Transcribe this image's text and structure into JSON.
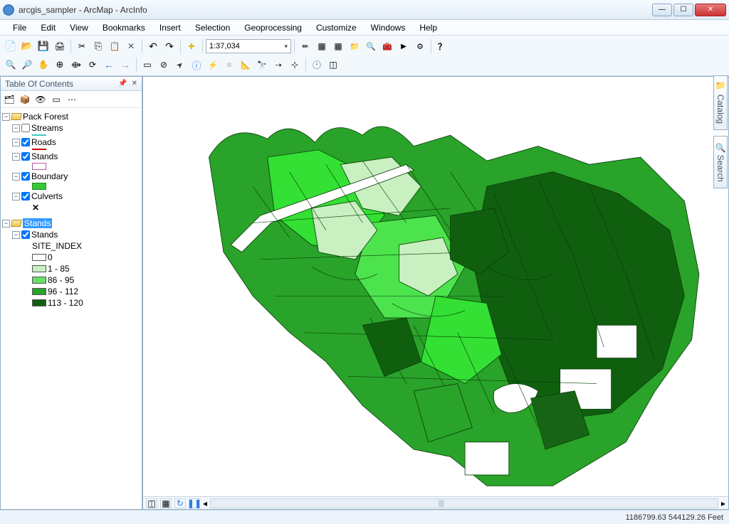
{
  "window": {
    "title": "arcgis_sampler - ArcMap - ArcInfo"
  },
  "menu": [
    "File",
    "Edit",
    "View",
    "Bookmarks",
    "Insert",
    "Selection",
    "Geoprocessing",
    "Customize",
    "Windows",
    "Help"
  ],
  "toolbar": {
    "scale": "1:37,034"
  },
  "toc": {
    "title": "Table Of Contents",
    "frames": [
      {
        "name": "Pack Forest",
        "layers": [
          {
            "name": "Streams",
            "checked": false,
            "swatch": {
              "type": "line",
              "color": "#3cc8c8"
            }
          },
          {
            "name": "Roads",
            "checked": true,
            "swatch": {
              "type": "line",
              "color": "#cc0000"
            }
          },
          {
            "name": "Stands",
            "checked": true,
            "swatch": {
              "type": "rect",
              "fill": "none",
              "stroke": "#b955aa"
            }
          },
          {
            "name": "Boundary",
            "checked": true,
            "swatch": {
              "type": "rect",
              "fill": "#33cc33",
              "stroke": "#228822"
            }
          },
          {
            "name": "Culverts",
            "checked": true,
            "swatch": {
              "type": "point",
              "glyph": "✕"
            }
          }
        ]
      },
      {
        "name": "Stands",
        "selected": true,
        "layers": [
          {
            "name": "Stands",
            "checked": true,
            "symbology": {
              "field": "SITE_INDEX",
              "classes": [
                {
                  "label": "0",
                  "fill": "#ffffff"
                },
                {
                  "label": "1 - 85",
                  "fill": "#c8f0c1"
                },
                {
                  "label": "86 - 95",
                  "fill": "#66e066"
                },
                {
                  "label": "96 - 112",
                  "fill": "#29a329"
                },
                {
                  "label": "113 - 120",
                  "fill": "#0f5f0f"
                }
              ]
            }
          }
        ]
      }
    ]
  },
  "right_tabs": [
    "Catalog",
    "Search"
  ],
  "status": {
    "coords": "1186799.63 544129.26 Feet"
  },
  "map_footer": {
    "buttons": [
      "data-view",
      "layout-view",
      "refresh",
      "pause"
    ]
  },
  "map": {
    "description": "Choropleth of forest stand polygons colored by SITE_INDEX, national-forest shaped blob with many irregular parcels.",
    "extent_label": "Pack Forest stands"
  }
}
